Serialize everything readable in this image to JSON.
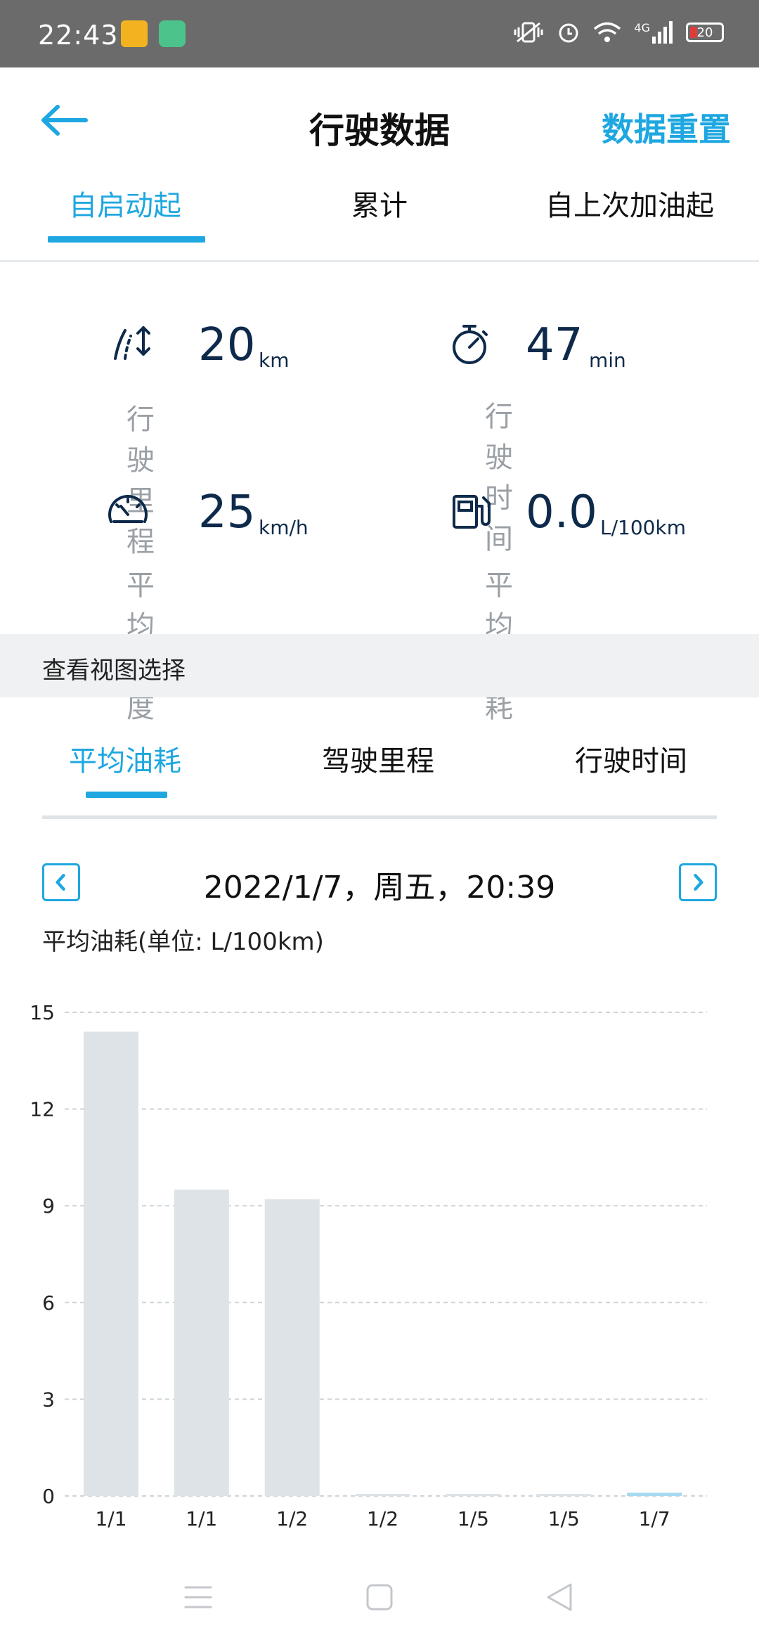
{
  "status_bar": {
    "time": "22:43",
    "network": "4G",
    "battery": "20"
  },
  "header": {
    "title": "行驶数据",
    "reset_label": "数据重置"
  },
  "top_tabs": [
    {
      "label": "自启动起",
      "active": true
    },
    {
      "label": "累计",
      "active": false
    },
    {
      "label": "自上次加油起",
      "active": false
    }
  ],
  "stats": [
    {
      "icon": "distance-icon",
      "value": "20",
      "unit": "km",
      "label": "行驶里程"
    },
    {
      "icon": "stopwatch-icon",
      "value": "47",
      "unit": "min",
      "label": "行驶时间"
    },
    {
      "icon": "speedometer-icon",
      "value": "25",
      "unit": "km/h",
      "label": "平均速度"
    },
    {
      "icon": "fuel-icon",
      "value": "0.0",
      "unit": "L/100km",
      "label": "平均油耗"
    }
  ],
  "section_title": "查看视图选择",
  "chart_tabs": [
    {
      "label": "平均油耗",
      "active": true
    },
    {
      "label": "驾驶里程",
      "active": false
    },
    {
      "label": "行驶时间",
      "active": false
    }
  ],
  "date_label": "2022/1/7，周五，20:39",
  "chart_title": "平均油耗(单位: L/100km)",
  "colors": {
    "accent": "#1ea7e0",
    "bar": "#dee3e7",
    "bar_highlight": "#a6d9f0",
    "value_text": "#0e2a4b",
    "label_text": "#9aa0a6"
  },
  "chart_data": {
    "type": "bar",
    "title": "平均油耗(单位: L/100km)",
    "categories": [
      "1/1",
      "1/1",
      "1/2",
      "1/2",
      "1/5",
      "1/5",
      "1/7"
    ],
    "values": [
      14.4,
      9.5,
      9.2,
      0.05,
      0.05,
      0.05,
      0.1
    ],
    "highlight_index": 6,
    "ylim": [
      0,
      15
    ],
    "yticks": [
      0,
      3,
      6,
      9,
      12,
      15
    ],
    "grid": true
  }
}
